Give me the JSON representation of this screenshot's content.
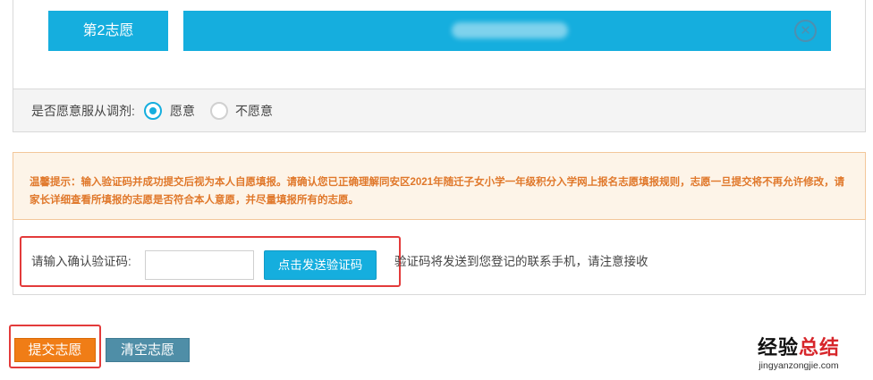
{
  "choice": {
    "label": "第2志愿",
    "value": "",
    "remove_icon": "close-circle-icon"
  },
  "adjust": {
    "label": "是否愿意服从调剂:",
    "options": [
      {
        "label": "愿意",
        "selected": true
      },
      {
        "label": "不愿意",
        "selected": false
      }
    ]
  },
  "notice": {
    "text": "温馨提示：输入验证码并成功提交后视为本人自愿填报。请确认您已正确理解同安区2021年随迁子女小学一年级积分入学网上报名志愿填报规则，志愿一旦提交将不再允许修改，请家长详细查看所填报的志愿是否符合本人意愿，并尽量填报所有的志愿。"
  },
  "verify": {
    "label": "请输入确认验证码:",
    "input_value": "",
    "send_button": "点击发送验证码",
    "hint": "验证码将发送到您登记的联系手机，请注意接收"
  },
  "actions": {
    "submit": "提交志愿",
    "clear": "清空志愿"
  },
  "watermark": {
    "title_part1": "经验",
    "title_part2": "总结",
    "url": "jingyanzongjie.com"
  },
  "colors": {
    "primary": "#15aede",
    "submit": "#f07d16",
    "clear": "#4f8ea7",
    "notice_text": "#e0782b",
    "highlight": "#e33b3b"
  }
}
